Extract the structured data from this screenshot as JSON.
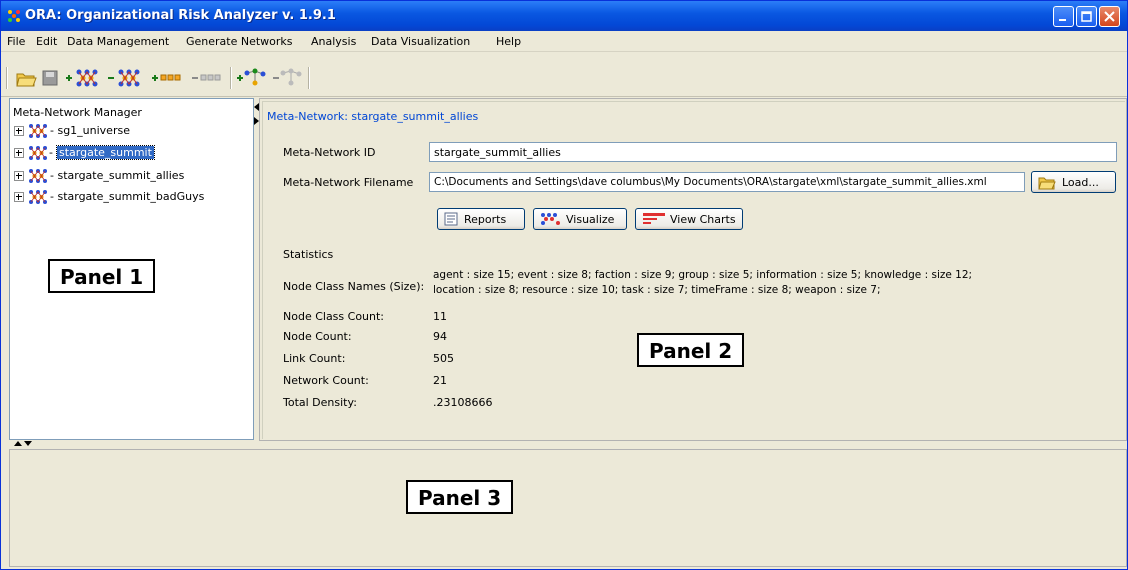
{
  "window": {
    "title": "ORA: Organizational Risk Analyzer v. 1.9.1",
    "titlebar_color": "#0a58e2"
  },
  "menu": {
    "items": [
      "File",
      "Edit",
      "Data Management",
      "Generate Networks",
      "Analysis",
      "Data Visualization",
      "Help"
    ]
  },
  "toolbar": {
    "tools": [
      "open-folder-icon",
      "save-icon",
      "add-meta-network-icon",
      "remove-meta-network-icon",
      "add-node-class-icon",
      "remove-node-class-icon",
      "add-network-icon",
      "remove-network-icon"
    ]
  },
  "panel1": {
    "title": "Meta-Network Manager",
    "items": [
      {
        "label": "- sg1_universe",
        "selected": false
      },
      {
        "label": "stargate_summit",
        "selected": true
      },
      {
        "label": "- stargate_summit_allies",
        "selected": false
      },
      {
        "label": "- stargate_summit_badGuys",
        "selected": false
      }
    ],
    "callout": "Panel 1"
  },
  "panel2": {
    "title": "Meta-Network: stargate_summit_allies",
    "id_label": "Meta-Network ID",
    "id_value": "stargate_summit_allies",
    "filename_label": "Meta-Network Filename",
    "filename_value": "C:\\Documents and Settings\\dave columbus\\My Documents\\ORA\\stargate\\xml\\stargate_summit_allies.xml",
    "load_button": "Load...",
    "reports_button": "Reports",
    "visualize_button": "Visualize",
    "charts_button": "View Charts",
    "statistics_heading": "Statistics",
    "node_class_names_label": "Node Class Names (Size):",
    "node_class_names_line1": "agent : size 15; event : size 8; faction : size 9; group : size 5; information : size 5; knowledge : size 12;",
    "node_class_names_line2": "location : size 8; resource : size 10; task : size 7; timeFrame : size 8; weapon : size 7;",
    "stats": [
      {
        "label": "Node Class Count:",
        "value": "11"
      },
      {
        "label": "Node Count:",
        "value": "94"
      },
      {
        "label": "Link Count:",
        "value": "505"
      },
      {
        "label": "Network Count:",
        "value": "21"
      },
      {
        "label": "Total Density:",
        "value": ".23108666"
      }
    ],
    "callout": "Panel 2"
  },
  "panel3": {
    "callout": "Panel 3"
  }
}
